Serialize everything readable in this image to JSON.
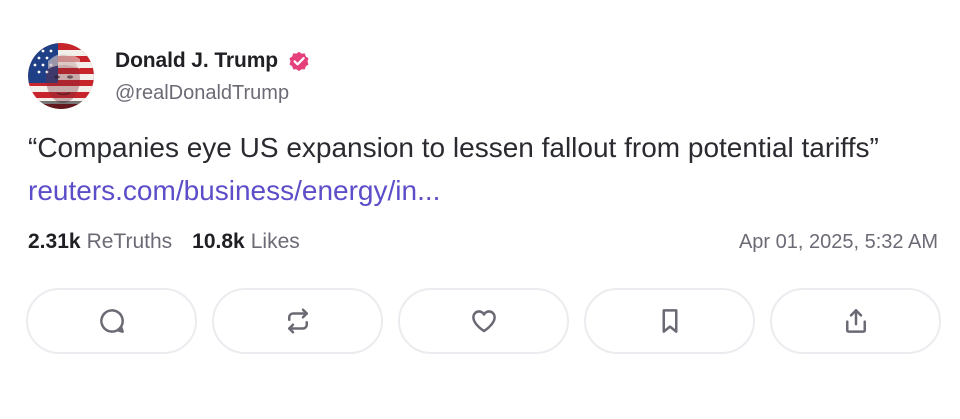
{
  "author": {
    "display_name": "Donald J. Trump",
    "handle": "@realDonaldTrump",
    "verified": true,
    "verified_color": "#e5407b"
  },
  "post": {
    "text": "“Companies eye US expansion to lessen fallout from potential tariffs”",
    "link_text": "reuters.com/business/energy/in...",
    "link_color": "#5c4ec9"
  },
  "stats": {
    "retruths_count": "2.31k",
    "retruths_label": "ReTruths",
    "likes_count": "10.8k",
    "likes_label": "Likes",
    "timestamp": "Apr 01, 2025, 5:32 AM"
  },
  "actions": [
    {
      "name": "reply",
      "icon": "comment-icon"
    },
    {
      "name": "retruth",
      "icon": "repost-icon"
    },
    {
      "name": "like",
      "icon": "heart-icon"
    },
    {
      "name": "bookmark",
      "icon": "bookmark-icon"
    },
    {
      "name": "share",
      "icon": "share-icon"
    }
  ]
}
